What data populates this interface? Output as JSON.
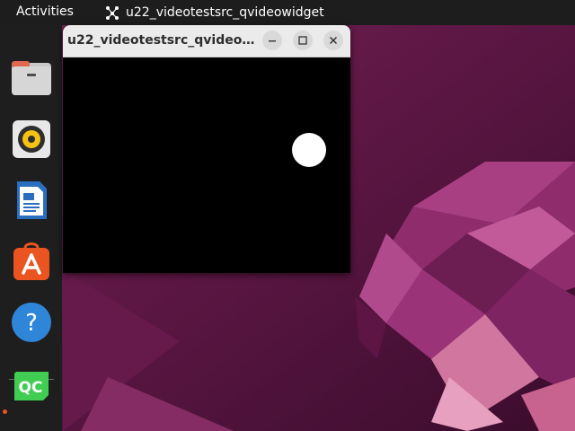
{
  "topbar": {
    "activities_label": "Activities",
    "app_name": "u22_videotestsrc_qvideowidget",
    "app_icon": "network-graph-icon"
  },
  "dock": {
    "items": [
      {
        "name": "files",
        "icon": "folder-icon"
      },
      {
        "name": "rhythmbox",
        "icon": "speaker-icon"
      },
      {
        "name": "libreoffice-writer",
        "icon": "document-icon"
      },
      {
        "name": "ubuntu-software",
        "icon": "shopping-bag-icon"
      },
      {
        "name": "help",
        "icon": "question-icon",
        "glyph": "?"
      },
      {
        "name": "qt-creator",
        "icon": "qt-icon",
        "label": "QC",
        "running": true
      }
    ]
  },
  "window": {
    "title": "u22_videotestsrc_qvideowidget",
    "controls": {
      "minimize": "minimize",
      "maximize": "maximize",
      "close": "close"
    },
    "video": {
      "background": "#000000",
      "ball_color": "#ffffff"
    }
  },
  "colors": {
    "wallpaper": "#5a1642",
    "accent": "#e95420",
    "topbar": "#1d1d1d"
  }
}
